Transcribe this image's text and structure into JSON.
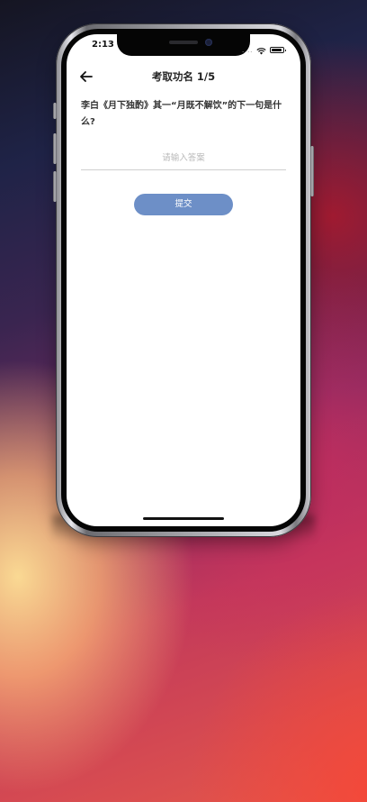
{
  "status_bar": {
    "time": "2:13",
    "signal_dots": "....",
    "icons": [
      "wifi-icon",
      "battery-icon"
    ]
  },
  "navbar": {
    "back_icon": "arrow-left-icon",
    "title": "考取功名 1/5"
  },
  "question": {
    "text": "李白《月下独酌》其一“月既不解饮”的下一句是什么?"
  },
  "answer": {
    "value": "",
    "placeholder": "请输入答案"
  },
  "submit": {
    "label": "提交"
  },
  "colors": {
    "accent": "#6d8fc7",
    "screen_bg": "#ffffff",
    "text_primary": "#222222"
  }
}
